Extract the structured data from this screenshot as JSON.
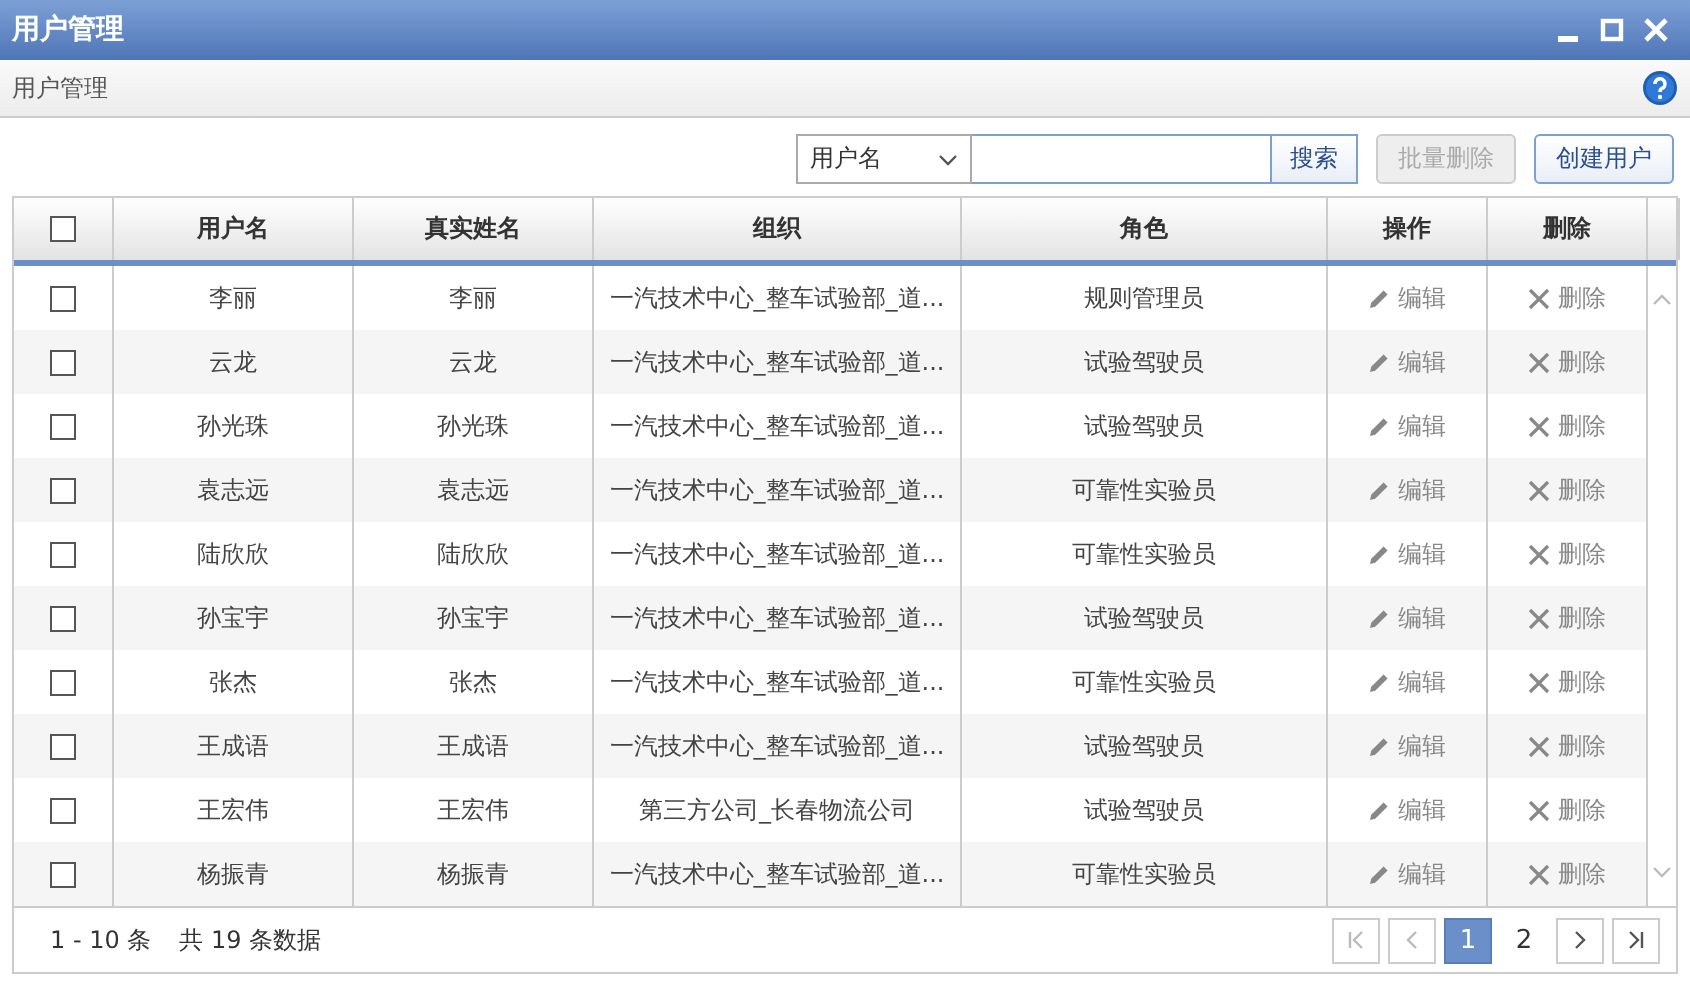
{
  "window": {
    "title": "用户管理"
  },
  "breadcrumb": "用户管理",
  "search": {
    "field": "用户名",
    "button": "搜索"
  },
  "buttons": [
    {
      "label": "批量删除",
      "disabled": true
    },
    {
      "label": "创建用户",
      "disabled": false
    }
  ],
  "table": {
    "select_all": {
      "checked": false
    },
    "columns": [
      "用户名",
      "真实姓名",
      "组织",
      "角色",
      "操作",
      "删除"
    ],
    "rows": [
      {
        "checked": false,
        "username": "李丽",
        "real_name": "李丽",
        "organization": "一汽技术中心_整车试验部_道...",
        "role": "规则管理员",
        "edit": "编辑",
        "delete": "删除"
      },
      {
        "checked": false,
        "username": "云龙",
        "real_name": "云龙",
        "organization": "一汽技术中心_整车试验部_道...",
        "role": "试验驾驶员",
        "edit": "编辑",
        "delete": "删除"
      },
      {
        "checked": false,
        "username": "孙光珠",
        "real_name": "孙光珠",
        "organization": "一汽技术中心_整车试验部_道...",
        "role": "试验驾驶员",
        "edit": "编辑",
        "delete": "删除"
      },
      {
        "checked": false,
        "username": "袁志远",
        "real_name": "袁志远",
        "organization": "一汽技术中心_整车试验部_道...",
        "role": "可靠性实验员",
        "edit": "编辑",
        "delete": "删除"
      },
      {
        "checked": false,
        "username": "陆欣欣",
        "real_name": "陆欣欣",
        "organization": "一汽技术中心_整车试验部_道...",
        "role": "可靠性实验员",
        "edit": "编辑",
        "delete": "删除"
      },
      {
        "checked": false,
        "username": "孙宝宇",
        "real_name": "孙宝宇",
        "organization": "一汽技术中心_整车试验部_道...",
        "role": "试验驾驶员",
        "edit": "编辑",
        "delete": "删除"
      },
      {
        "checked": false,
        "username": "张杰",
        "real_name": "张杰",
        "organization": "一汽技术中心_整车试验部_道...",
        "role": "可靠性实验员",
        "edit": "编辑",
        "delete": "删除"
      },
      {
        "checked": false,
        "username": "王成语",
        "real_name": "王成语",
        "organization": "一汽技术中心_整车试验部_道...",
        "role": "试验驾驶员",
        "edit": "编辑",
        "delete": "删除"
      },
      {
        "checked": false,
        "username": "王宏伟",
        "real_name": "王宏伟",
        "organization": "第三方公司_长春物流公司",
        "role": "试验驾驶员",
        "edit": "编辑",
        "delete": "删除"
      },
      {
        "checked": false,
        "username": "杨振青",
        "real_name": "杨振青",
        "organization": "一汽技术中心_整车试验部_道...",
        "role": "可靠性实验员",
        "edit": "编辑",
        "delete": "删除"
      }
    ]
  },
  "footer": {
    "range": "1 - 10 条",
    "total": "共 19 条数据"
  },
  "pager": {
    "first_disabled": true,
    "prev_disabled": true,
    "next_disabled": false,
    "last_disabled": false,
    "pages": [
      {
        "label": "1",
        "selected": true
      },
      {
        "label": "2",
        "selected": false
      }
    ]
  }
}
